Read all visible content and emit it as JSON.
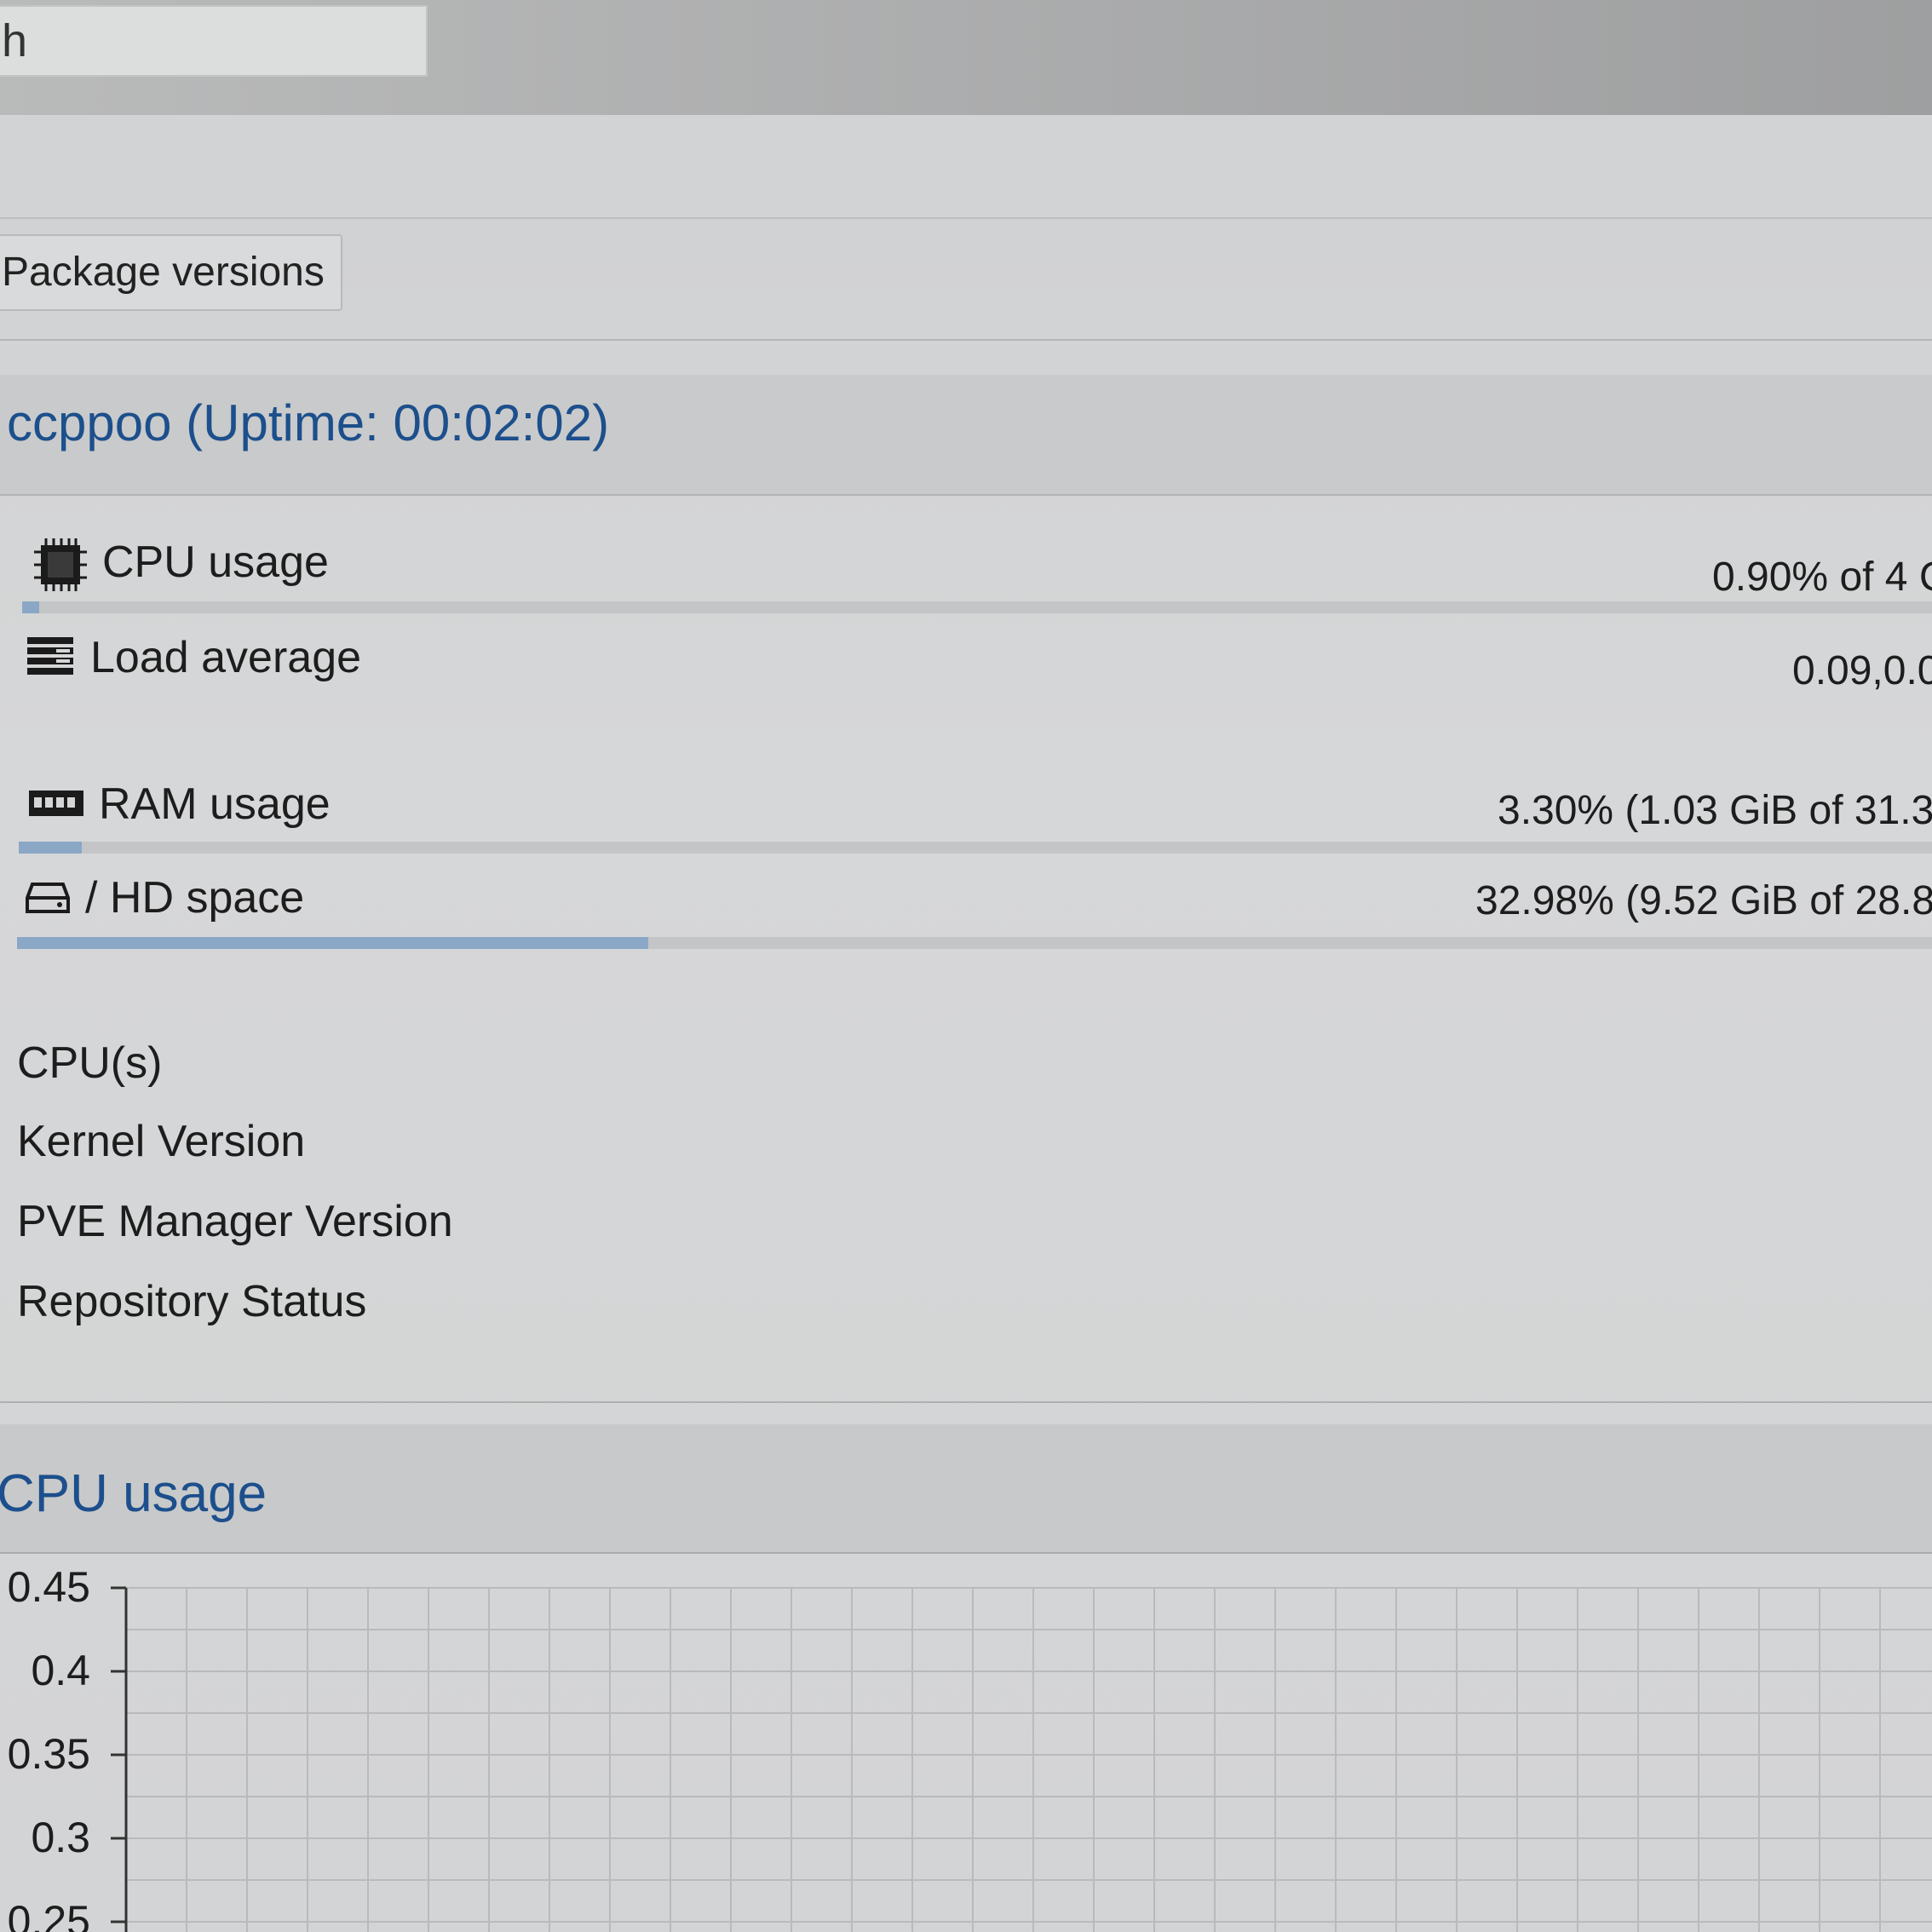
{
  "search": {
    "value": "h"
  },
  "toolbar": {
    "package_versions_label": "Package versions"
  },
  "node": {
    "title": "ccppoo (Uptime: 00:02:02)"
  },
  "stats": [
    {
      "label": "CPU usage",
      "value": "0.90% of 4 C",
      "icon": "cpu-icon",
      "progress": 0.009
    },
    {
      "label": "Load average",
      "value": "0.09,0.0",
      "icon": "load-average-icon"
    },
    {
      "label": "RAM usage",
      "value": "3.30% (1.03 GiB of 31.3",
      "icon": "ram-icon",
      "progress": 0.033
    },
    {
      "label": "/ HD space",
      "value": "32.98% (9.52 GiB of 28.8",
      "icon": "hdd-icon",
      "progress": 0.3298
    }
  ],
  "info": [
    {
      "label": "CPU(s)"
    },
    {
      "label": "Kernel Version"
    },
    {
      "label": "PVE Manager Version"
    },
    {
      "label": "Repository Status"
    }
  ],
  "chart_section": {
    "title": "CPU usage"
  },
  "colors": {
    "accent_text": "#1c4f8c",
    "progress_fill": "#8aa7c6",
    "grid": "#b9babb"
  },
  "chart_data": {
    "type": "line",
    "title": "CPU usage",
    "y_ticks": [
      "0.45",
      "0.4",
      "0.35",
      "0.3",
      "0.25"
    ],
    "ylim": [
      0.25,
      0.45
    ],
    "grid": true,
    "series": []
  }
}
